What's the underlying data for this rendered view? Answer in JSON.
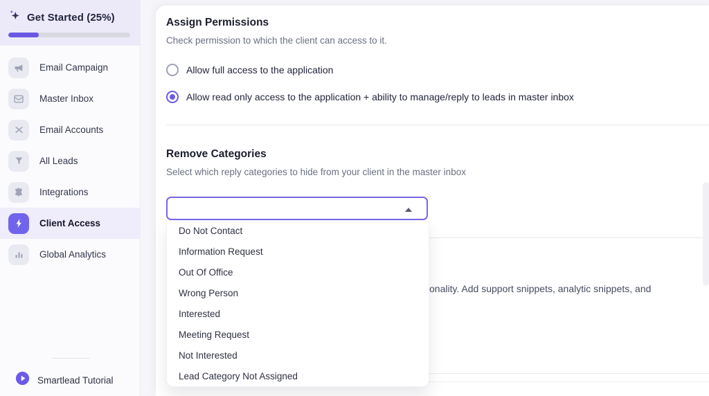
{
  "sidebar": {
    "get_started": {
      "label": "Get Started (25%)",
      "progress_percent": 25
    },
    "items": [
      {
        "label": "Email Campaign",
        "icon": "megaphone-icon"
      },
      {
        "label": "Master Inbox",
        "icon": "envelope-icon"
      },
      {
        "label": "Email Accounts",
        "icon": "email-swap-icon"
      },
      {
        "label": "All Leads",
        "icon": "funnel-icon"
      },
      {
        "label": "Integrations",
        "icon": "puzzle-icon"
      },
      {
        "label": "Client Access",
        "icon": "bolt-icon",
        "active": true
      },
      {
        "label": "Global Analytics",
        "icon": "bar-chart-icon"
      }
    ],
    "tutorial": {
      "label": "Smartlead Tutorial",
      "icon": "play-icon"
    }
  },
  "main": {
    "assign_permissions": {
      "title": "Assign Permissions",
      "description": "Check permission to which the client can access to it.",
      "options": [
        {
          "label": "Allow full access to the application",
          "selected": false
        },
        {
          "label": "Allow read only access to the application + ability to manage/reply to leads in master inbox",
          "selected": true
        }
      ]
    },
    "remove_categories": {
      "title": "Remove Categories",
      "description": "Select which reply categories to hide from your client in the master inbox",
      "select_value": "",
      "dropdown_options": [
        "Do Not Contact",
        "Information Request",
        "Out Of Office",
        "Wrong Person",
        "Interested",
        "Meeting Request",
        "Not Interested",
        "Lead Category Not Assigned"
      ]
    },
    "partially_hidden_text": "onality. Add support snippets, analytic snippets, and"
  },
  "colors": {
    "accent": "#6C5BE8",
    "progress_fill": "#6A58E3",
    "get_started_bg": "#ECEAF9",
    "active_row_bg": "#EFECFB",
    "select_border": "#7566E5",
    "divider": "#E7E7EE",
    "muted_text": "#6A7080"
  }
}
